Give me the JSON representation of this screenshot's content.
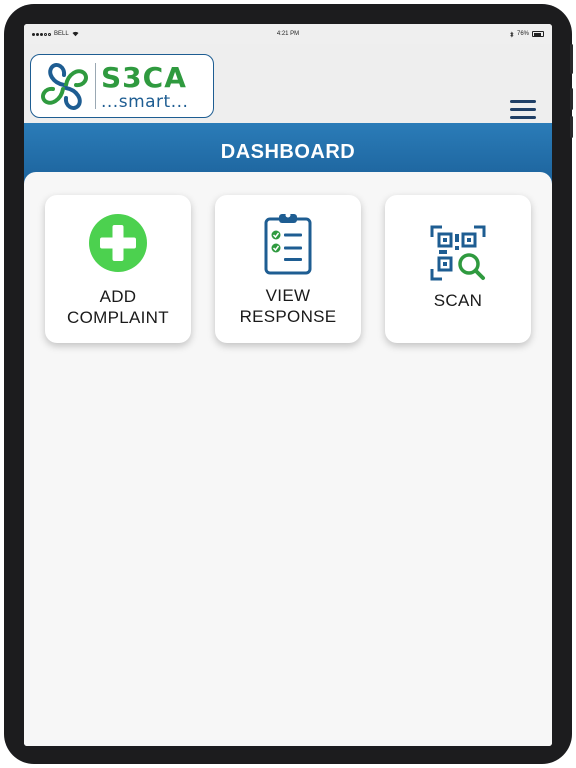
{
  "status_bar": {
    "carrier": "BELL",
    "time": "4:21 PM",
    "battery": "76%"
  },
  "header": {
    "logo_main": "S3CA",
    "logo_sub": "...smart..."
  },
  "title_bar": {
    "title": "DASHBOARD"
  },
  "cards": [
    {
      "line1": "ADD",
      "line2": "COMPLAINT",
      "icon": "plus-circle-icon"
    },
    {
      "line1": "VIEW",
      "line2": "RESPONSE",
      "icon": "clipboard-checklist-icon"
    },
    {
      "line1": "SCAN",
      "icon": "qr-scan-icon"
    }
  ],
  "colors": {
    "brand_blue": "#1e5d92",
    "brand_green": "#2f9a3f",
    "accent_green": "#4cd14f",
    "titlebar": "#2373b0"
  }
}
